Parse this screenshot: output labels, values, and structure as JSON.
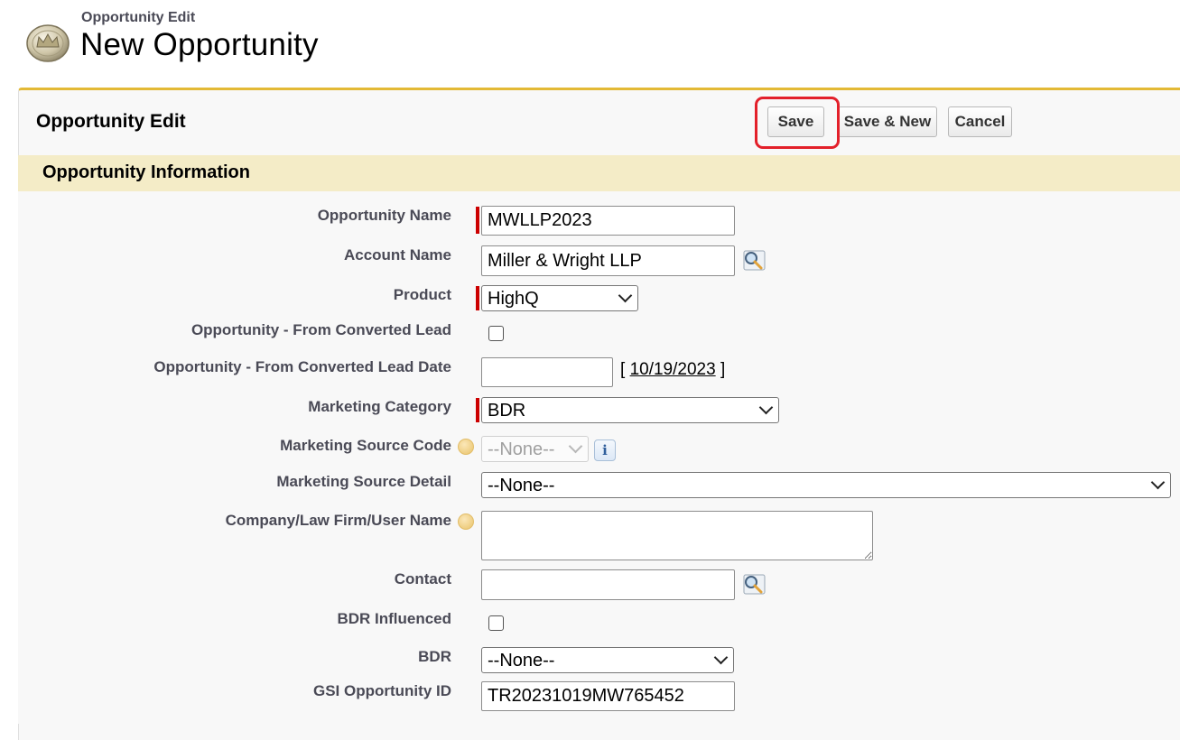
{
  "header": {
    "subtitle": "Opportunity Edit",
    "title": "New Opportunity",
    "icon": "crown-coin-icon"
  },
  "panel": {
    "title": "Opportunity Edit",
    "buttons": {
      "save": "Save",
      "save_new": "Save & New",
      "cancel": "Cancel"
    },
    "highlight_color": "#e3202a",
    "accent_color": "#e3b936"
  },
  "section": {
    "title": "Opportunity Information"
  },
  "fields": {
    "opportunity_name": {
      "label": "Opportunity Name",
      "value": "MWLLP2023",
      "required": true
    },
    "account_name": {
      "label": "Account Name",
      "value": "Miller & Wright LLP",
      "icon": "lookup-magnifier-icon"
    },
    "product": {
      "label": "Product",
      "value": "HighQ",
      "required": true
    },
    "from_converted_lead": {
      "label": "Opportunity - From Converted Lead",
      "checked": false
    },
    "from_converted_lead_date": {
      "label": "Opportunity - From Converted Lead Date",
      "value": "",
      "date_link_open": "[",
      "date_link": "10/19/2023",
      "date_link_close": "]"
    },
    "marketing_category": {
      "label": "Marketing Category",
      "value": "BDR",
      "required": true
    },
    "marketing_source_code": {
      "label": "Marketing Source Code",
      "value": "--None--",
      "disabled": true,
      "info_glyph": "i"
    },
    "marketing_source_detail": {
      "label": "Marketing Source Detail",
      "value": "--None--"
    },
    "company_name": {
      "label": "Company/Law Firm/User Name",
      "value": ""
    },
    "contact": {
      "label": "Contact",
      "value": "",
      "icon": "lookup-magnifier-icon"
    },
    "bdr_influenced": {
      "label": "BDR Influenced",
      "checked": false
    },
    "bdr": {
      "label": "BDR",
      "value": "--None--"
    },
    "gsi_opportunity_id": {
      "label": "GSI Opportunity ID",
      "value": "TR20231019MW765452"
    }
  }
}
